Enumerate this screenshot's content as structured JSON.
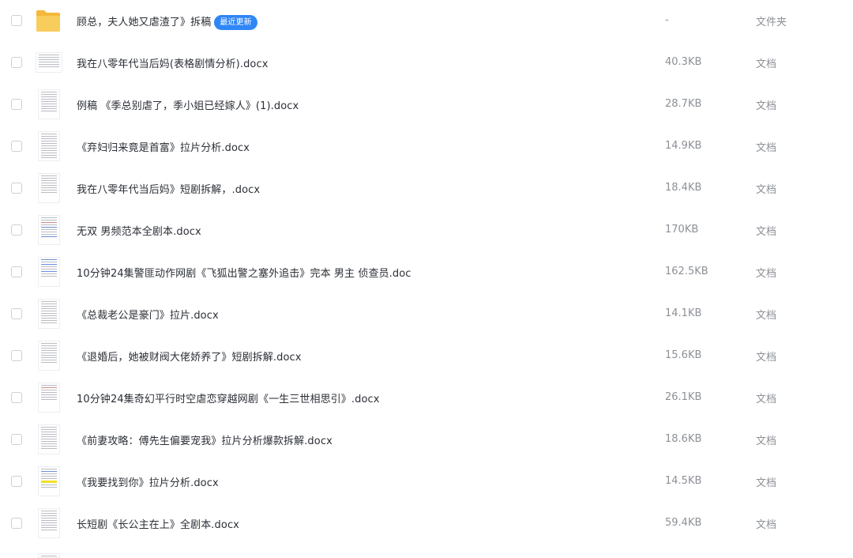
{
  "folder_badge": "最近更新",
  "rows": [
    {
      "name": "顾总，夫人她又虐渣了》拆稿",
      "size": "-",
      "type": "文件夹"
    },
    {
      "name": "我在八零年代当后妈(表格剧情分析).docx",
      "size": "40.3KB",
      "type": "文档"
    },
    {
      "name": "例稿 《季总别虐了，季小姐已经嫁人》(1).docx",
      "size": "28.7KB",
      "type": "文档"
    },
    {
      "name": "《弃妇归来竟是首富》拉片分析.docx",
      "size": "14.9KB",
      "type": "文档"
    },
    {
      "name": "我在八零年代当后妈》短剧拆解，.docx",
      "size": "18.4KB",
      "type": "文档"
    },
    {
      "name": "无双 男频范本全剧本.docx",
      "size": "170KB",
      "type": "文档"
    },
    {
      "name": "10分钟24集警匪动作网剧《飞狐出警之塞外追击》完本 男主 侦查员.doc",
      "size": "162.5KB",
      "type": "文档"
    },
    {
      "name": "《总裁老公是豪门》拉片.docx",
      "size": "14.1KB",
      "type": "文档"
    },
    {
      "name": "《退婚后，她被财阀大佬娇养了》短剧拆解.docx",
      "size": "15.6KB",
      "type": "文档"
    },
    {
      "name": "10分钟24集奇幻平行时空虐恋穿越网剧《一生三世相思引》.docx",
      "size": "26.1KB",
      "type": "文档"
    },
    {
      "name": "《前妻攻略：傅先生偏要宠我》拉片分析爆款拆解.docx",
      "size": "18.6KB",
      "type": "文档"
    },
    {
      "name": "《我要找到你》拉片分析.docx",
      "size": "14.5KB",
      "type": "文档"
    },
    {
      "name": "长短剧《长公主在上》全剧本.docx",
      "size": "59.4KB",
      "type": "文档"
    }
  ],
  "icons": {
    "folder": "folder-icon",
    "document": "document-thumbnail-icon"
  },
  "colors": {
    "badge": "#2f86f6",
    "folder": "#f7c244",
    "secondary_text": "#8c9096"
  }
}
